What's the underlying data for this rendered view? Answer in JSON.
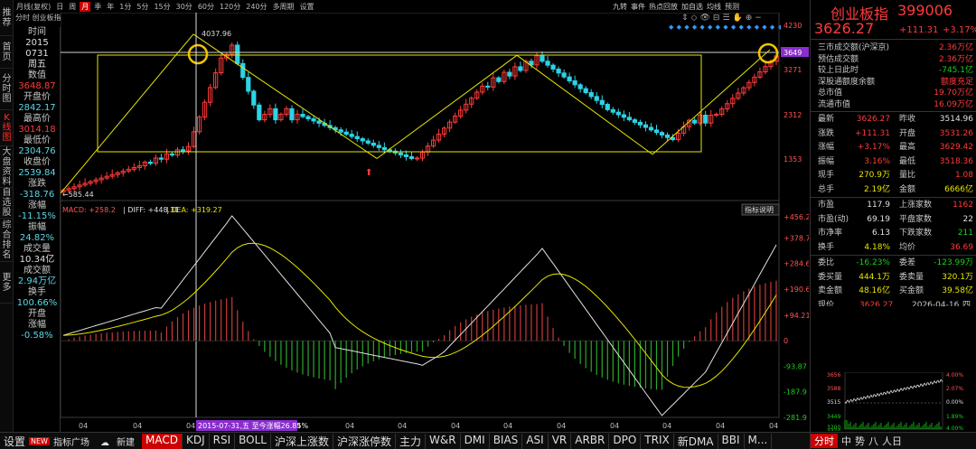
{
  "left_tabs": [
    {
      "label": "推荐",
      "active": false
    },
    {
      "label": "首页",
      "active": false
    },
    {
      "label": "分时图",
      "active": false
    },
    {
      "label": "K线图",
      "active": true
    },
    {
      "label": "大盘资料",
      "active": false
    },
    {
      "label": "自选股",
      "active": false
    },
    {
      "label": "综合排名",
      "active": false
    },
    {
      "label": "更多",
      "active": false
    }
  ],
  "toolbar": {
    "items": [
      "月线(复权)",
      "日",
      "周",
      "月",
      "季",
      "年",
      "1分",
      "5分",
      "15分",
      "30分",
      "60分",
      "120分",
      "240分",
      "多周期",
      "设置"
    ],
    "selected": "月",
    "subtitle": "分时 创业板指",
    "right_items": [
      "九转",
      "事件",
      "热点回放",
      "加自选",
      "均线",
      "预测"
    ],
    "right_icons": [
      "⇕",
      "◇",
      "👁",
      "⊟",
      "☰",
      "✋",
      "⊕",
      "−"
    ]
  },
  "info_col": [
    {
      "label": "时间",
      "value": "2015",
      "value2": "0731",
      "value3": "周五",
      "color": "white"
    },
    {
      "label": "数值",
      "value": "3648.87",
      "color": "red"
    },
    {
      "label": "开盘价",
      "value": "2842.17",
      "color": "cyan"
    },
    {
      "label": "最高价",
      "value": "3014.18",
      "color": "red"
    },
    {
      "label": "最低价",
      "value": "2304.76",
      "color": "cyan"
    },
    {
      "label": "收盘价",
      "value": "2539.84",
      "color": "cyan"
    },
    {
      "label": "涨跌",
      "value": "-318.76",
      "color": "cyan"
    },
    {
      "label": "涨幅",
      "value": "-11.15%",
      "color": "cyan"
    },
    {
      "label": "振幅",
      "value": "24.82%",
      "color": "cyan"
    },
    {
      "label": "成交量",
      "value": "10.34亿",
      "color": "white"
    },
    {
      "label": "成交额",
      "value": "2.94万亿",
      "color": "cyan"
    },
    {
      "label": "换手",
      "value": "100.66%",
      "color": "cyan"
    },
    {
      "label": "开盘涨幅",
      "value": "-0.58%",
      "color": "cyan"
    }
  ],
  "chart": {
    "peak_label": "4037.96",
    "low_label": "585.44",
    "price_axis": [
      "4230",
      "3649",
      "3271",
      "2312",
      "1353"
    ],
    "price_badge": "3649",
    "macd_header": {
      "name": "MACD",
      "macd": "MACD: +258.2",
      "diff": "DIFF: +448.31",
      "dea": "DEA: +319.27"
    },
    "indicator_btn": "指标说明",
    "macd_axis": [
      "+456.2",
      "+378.7",
      "+284.6",
      "+190.6",
      "+94.21",
      "0",
      "-93.87",
      "-187.9",
      "-281.9"
    ],
    "x_labels": [
      "04",
      "04",
      "04",
      "04",
      "04",
      "04",
      "04",
      "04",
      "04",
      "04",
      "04",
      "04",
      "04",
      "04"
    ],
    "hover_label": "2015-07-31,五 至今涨幅26.85%"
  },
  "right_panel": {
    "title": "创业板指",
    "code": "399006",
    "price": "3626.27",
    "change": "+111.31",
    "pct": "+3.17%",
    "rows1": [
      {
        "label": "三市成交额(沪深京)",
        "value": "2.36万亿",
        "color": "red"
      },
      {
        "label": "预估成交额",
        "value": "2.36万亿",
        "color": "red"
      },
      {
        "label": "较上日此时",
        "value": "-745.1亿",
        "color": "green"
      },
      {
        "label": "深股通额度余额",
        "value": "额度充足",
        "color": "red"
      },
      {
        "label": "总市值",
        "value": "19.70万亿",
        "color": "red"
      },
      {
        "label": "流通市值",
        "value": "16.09万亿",
        "color": "red"
      }
    ],
    "quote_rows": [
      [
        "最新",
        "3626.27",
        "red",
        "昨收",
        "3514.96",
        "white"
      ],
      [
        "涨跌",
        "+111.31",
        "red",
        "开盘",
        "3531.26",
        "red"
      ],
      [
        "涨幅",
        "+3.17%",
        "red",
        "最高",
        "3629.42",
        "red"
      ],
      [
        "振幅",
        "3.16%",
        "red",
        "最低",
        "3518.36",
        "red"
      ],
      [
        "现手",
        "270.9万",
        "yellow",
        "量比",
        "1.08",
        "red"
      ],
      [
        "总手",
        "2.19亿",
        "yellow",
        "金额",
        "6666亿",
        "yellow"
      ]
    ],
    "market_rows": [
      [
        "市盈",
        "117.9",
        "white",
        "上涨家数",
        "1162",
        "red"
      ],
      [
        "市盈(动)",
        "69.19",
        "white",
        "平盘家数",
        "22",
        "white"
      ],
      [
        "市净率",
        "6.13",
        "white",
        "下跌家数",
        "211",
        "green"
      ],
      [
        "换手",
        "4.18%",
        "yellow",
        "均价",
        "36.69",
        "red"
      ]
    ],
    "order_rows": [
      [
        "委比",
        "-16.23%",
        "green",
        "委差",
        "-123.99万",
        "green"
      ],
      [
        "委买量",
        "444.1万",
        "yellow",
        "委卖量",
        "320.1万",
        "yellow"
      ],
      [
        "卖金额",
        "48.16亿",
        "yellow",
        "买金额",
        "39.58亿",
        "yellow"
      ]
    ],
    "cut_row": [
      "现价",
      "3626.27",
      "2026-04-16",
      "四"
    ],
    "mini_axis_left": [
      "3656",
      "3588",
      "3515",
      "3449",
      "3374",
      "3200"
    ],
    "mini_axis_right": [
      "4.00%",
      "2.07%",
      "0.00%",
      "1.89%",
      "4.00%"
    ],
    "bottom_tabs": [
      "分时",
      "中",
      "势",
      "八",
      "人日"
    ]
  },
  "bottom_bar": {
    "settings": "设置",
    "new_badge": "NEW",
    "plaza": "指标广场",
    "new_btn": "新建",
    "tabs": [
      "MACD",
      "KDJ",
      "RSI",
      "BOLL",
      "沪深上涨数",
      "沪深涨停数",
      "主力",
      "W&R",
      "DMI",
      "BIAS",
      "ASI",
      "VR",
      "ARBR",
      "DPO",
      "TRIX",
      "新DMA",
      "BBI",
      "M..."
    ],
    "active": "MACD"
  },
  "colors": {
    "up": "#ff3b3b",
    "down": "#19d219",
    "candle_down": "#2cd3e6",
    "yellow": "#e6e600",
    "accent": "#cc0000",
    "circle": "#f2c300"
  }
}
